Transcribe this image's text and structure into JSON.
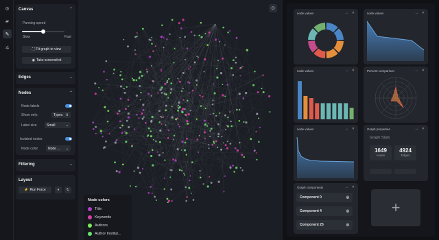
{
  "rail": {
    "icons": [
      "settings-icon",
      "folder-icon",
      "pen-icon",
      "bug-icon"
    ]
  },
  "panel": {
    "canvas": {
      "title": "Canvas",
      "speed_label": "Panning speed",
      "slow": "Slow",
      "fast": "Fast",
      "speed_level": 0.5,
      "fit_btn": "Fit graph to view",
      "screenshot_btn": "Take screenshot"
    },
    "edges": {
      "title": "Edges"
    },
    "nodes": {
      "title": "Nodes",
      "node_labels": "Node labels",
      "show_only": "Show only:",
      "show_only_value": "Types",
      "label_size": "Label size",
      "label_size_value": "Small",
      "isolated": "Isolated nodes",
      "node_color": "Node color",
      "node_color_value": "Node ..."
    },
    "filtering": {
      "title": "Filtering"
    },
    "layout": {
      "title": "Layout",
      "run_btn": "Run Force"
    }
  },
  "legend": {
    "title": "Node colors",
    "items": [
      {
        "label": "Title",
        "color": "#b13fc9"
      },
      {
        "label": "Keywords",
        "color": "#d63fa6"
      },
      {
        "label": "Authors",
        "color": "#7bea5a"
      },
      {
        "label": "Author Institut...",
        "color": "#66e26a"
      }
    ]
  },
  "widgets": {
    "donut": {
      "title": "node values",
      "colors": [
        "#4a86c5",
        "#e58e3c",
        "#e05a4c",
        "#c44c8a",
        "#6cb7b3",
        "#73b06f"
      ]
    },
    "area1": {
      "title": "node values"
    },
    "bars": {
      "title": "node values",
      "values": [
        0.9,
        0.55,
        0.5,
        0.38,
        0.38,
        0.38,
        0.38,
        0.38,
        0.38,
        0.27
      ],
      "colors": [
        "#4a86c5",
        "#e58e3c",
        "#e05a4c",
        "#e05a4c",
        "#6cb7b3",
        "#6cb7b3",
        "#6cb7b3",
        "#6cb7b3",
        "#6cb7b3",
        "#73b06f"
      ]
    },
    "radar": {
      "title": "Percent comparison"
    },
    "area2": {
      "title": "node values"
    },
    "properties": {
      "title": "Graph properties",
      "subtitle": "Graph Stats",
      "nodes_value": "1649",
      "nodes_label": "nodes",
      "edges_value": "4924",
      "edges_label": "Edges"
    },
    "components": {
      "title": "Graph components",
      "items": [
        "Component 0",
        "Component 4",
        "Component 25"
      ]
    }
  }
}
